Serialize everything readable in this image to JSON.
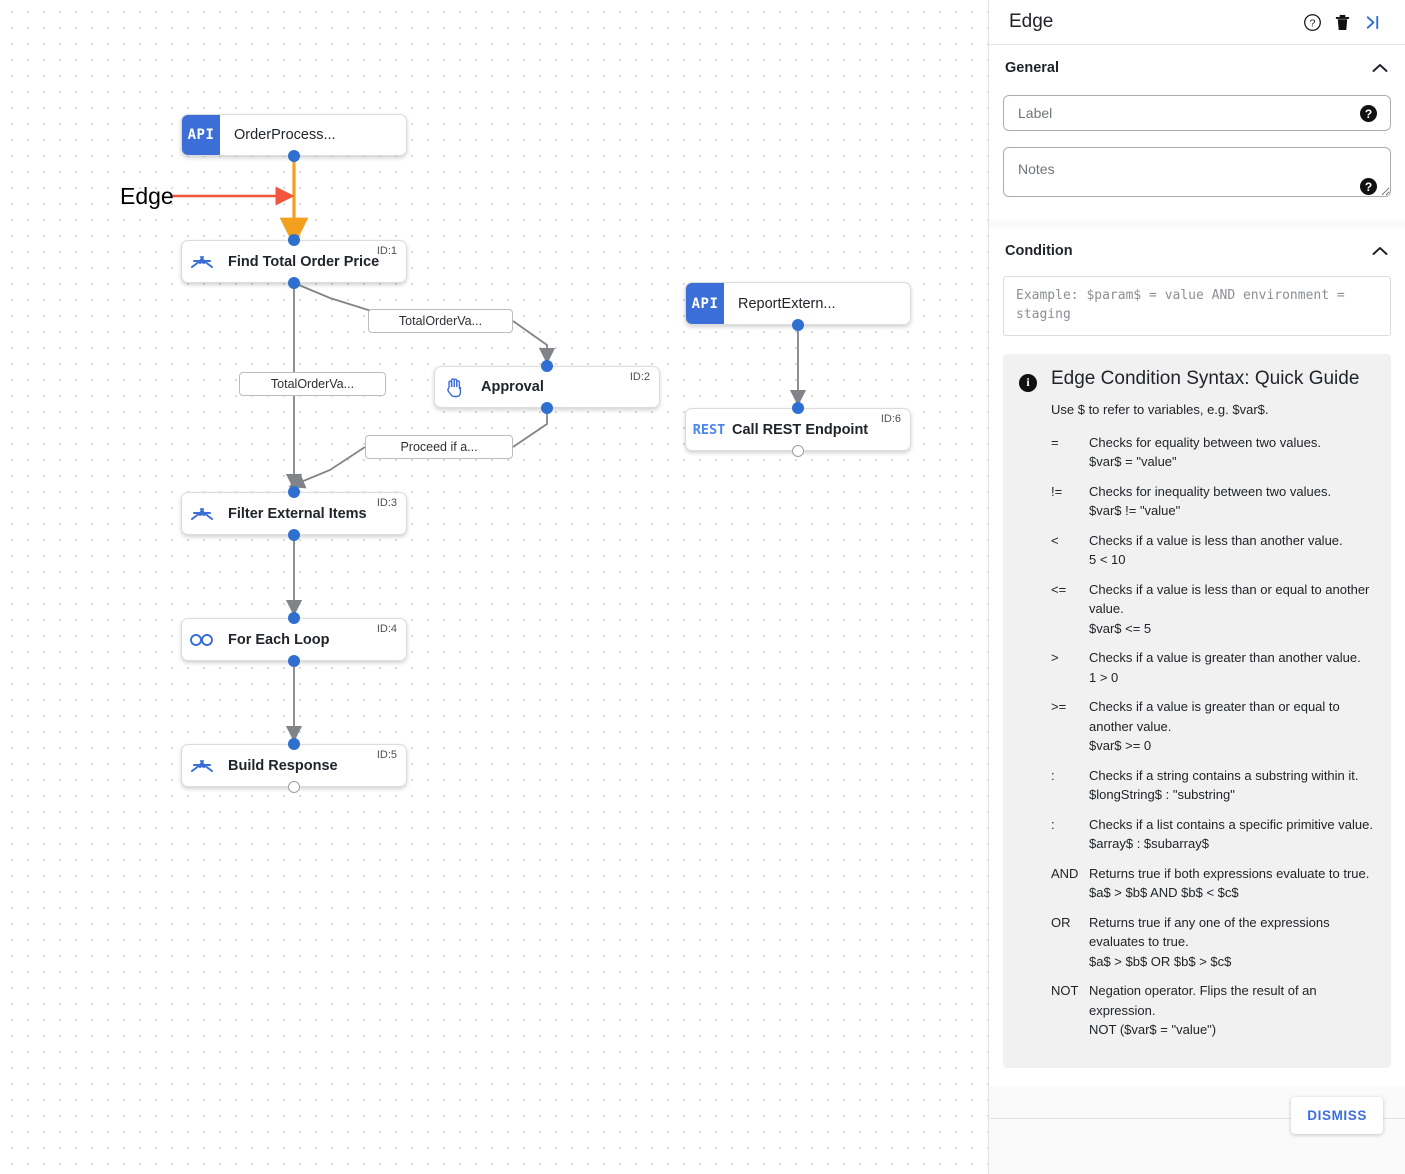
{
  "canvas": {
    "annotation": {
      "label": "Edge",
      "arrow_color": "#f2573d"
    },
    "nodes": [
      {
        "id": "n-orderprocess",
        "kind": "api",
        "badge": "API",
        "title": "OrderProcess...",
        "id_tag": ""
      },
      {
        "id": "n-find-total",
        "kind": "step",
        "icon": "merge-arrows-icon",
        "title": "Find Total Order Price",
        "id_tag": "ID:1"
      },
      {
        "id": "n-approval",
        "kind": "step",
        "icon": "hand-icon",
        "title": "Approval",
        "id_tag": "ID:2"
      },
      {
        "id": "n-filter",
        "kind": "step",
        "icon": "merge-arrows-icon",
        "title": "Filter External Items",
        "id_tag": "ID:3"
      },
      {
        "id": "n-foreach",
        "kind": "step",
        "icon": "infinity-loop-icon",
        "title": "For Each Loop",
        "id_tag": "ID:4"
      },
      {
        "id": "n-build",
        "kind": "step",
        "icon": "merge-arrows-icon",
        "title": "Build Response",
        "id_tag": "ID:5"
      },
      {
        "id": "n-reportextern",
        "kind": "api",
        "badge": "API",
        "title": "ReportExtern...",
        "id_tag": ""
      },
      {
        "id": "n-callrest",
        "kind": "rest",
        "badge": "REST",
        "title": "Call REST Endpoint",
        "id_tag": "ID:6"
      }
    ],
    "edge_labels": [
      {
        "id": "el-1",
        "text": "TotalOrderVa..."
      },
      {
        "id": "el-2",
        "text": "TotalOrderVa..."
      },
      {
        "id": "el-3",
        "text": "Proceed if a..."
      }
    ],
    "colors": {
      "node_badge_blue": "#3b6ed6",
      "port_blue": "#2f6fd0",
      "selected_edge_orange": "#f5a623",
      "edge_gray": "#808488"
    }
  },
  "panel": {
    "title": "Edge",
    "header_icons": [
      {
        "name": "help-icon",
        "glyph": "?"
      },
      {
        "name": "delete-icon",
        "glyph": "trash"
      },
      {
        "name": "collapse-panel-icon",
        "glyph": ">|"
      }
    ],
    "general": {
      "heading": "General",
      "label_placeholder": "Label",
      "label_value": "",
      "notes_placeholder": "Notes",
      "notes_value": "",
      "help_glyph": "?"
    },
    "condition": {
      "heading": "Condition",
      "placeholder": "Example: $param$ = value AND environment = staging",
      "value": ""
    },
    "guide": {
      "title": "Edge Condition Syntax: Quick Guide",
      "intro": "Use $ to refer to variables, e.g. $var$.",
      "rows": [
        {
          "op": "=",
          "desc": "Checks for equality between two values.",
          "ex": "$var$ = \"value\""
        },
        {
          "op": "!=",
          "desc": "Checks for inequality between two values.",
          "ex": "$var$ != \"value\""
        },
        {
          "op": "<",
          "desc": "Checks if a value is less than another value.",
          "ex": "5 < 10"
        },
        {
          "op": "<=",
          "desc": "Checks if a value is less than or equal to another value.",
          "ex": "$var$ <= 5"
        },
        {
          "op": ">",
          "desc": "Checks if a value is greater than another value.",
          "ex": "1 > 0"
        },
        {
          "op": ">=",
          "desc": "Checks if a value is greater than or equal to another value.",
          "ex": "$var$ >= 0"
        },
        {
          "op": ":",
          "desc": "Checks if a string contains a substring within it.",
          "ex": "$longString$ : \"substring\""
        },
        {
          "op": ":",
          "desc": "Checks if a list contains a specific primitive value.",
          "ex": "$array$ : $subarray$"
        },
        {
          "op": "AND",
          "desc": "Returns true if both expressions evaluate to true.",
          "ex": "$a$ > $b$ AND $b$ < $c$"
        },
        {
          "op": "OR",
          "desc": "Returns true if any one of the expressions evaluates to true.",
          "ex": "$a$ > $b$ OR $b$ > $c$"
        },
        {
          "op": "NOT",
          "desc": "Negation operator. Flips the result of an expression.",
          "ex": "NOT ($var$ = \"value\")"
        }
      ]
    },
    "footer": {
      "dismiss_label": "DISMISS",
      "dismiss_color": "#3b6ee0"
    }
  }
}
